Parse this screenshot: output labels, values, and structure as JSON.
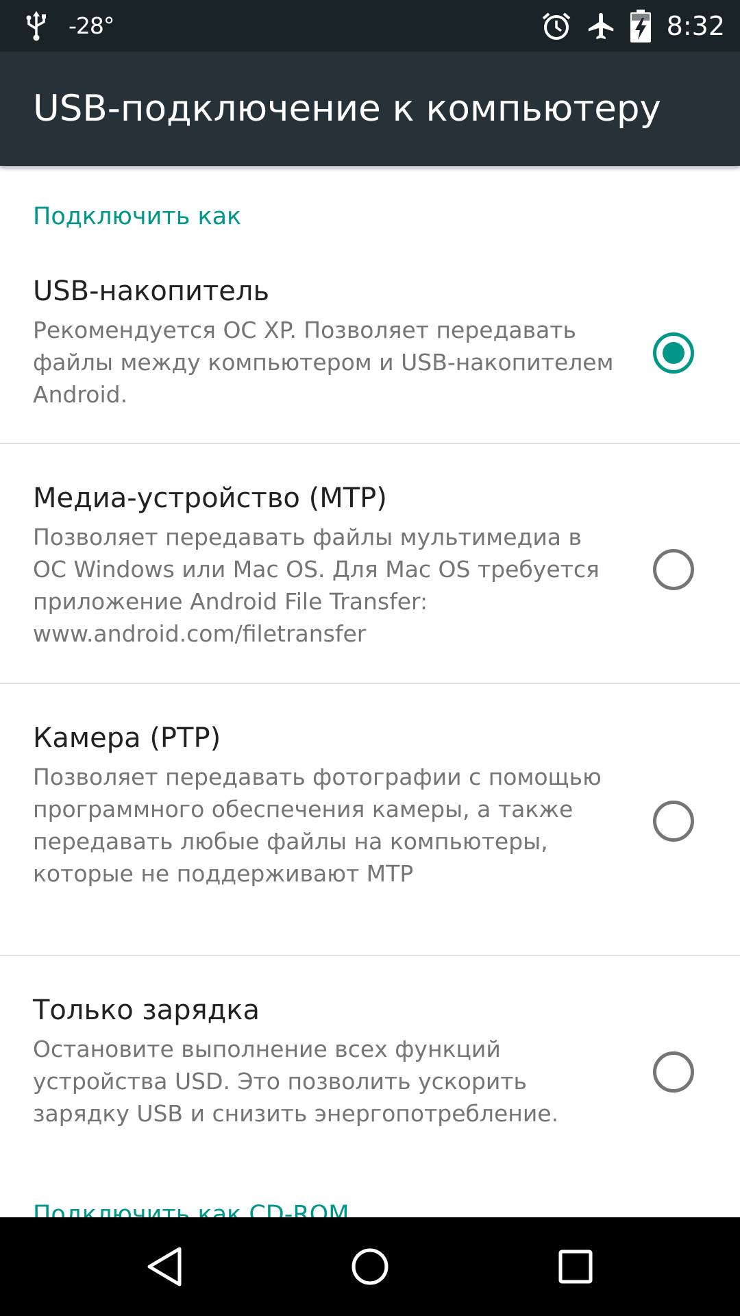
{
  "status_bar": {
    "temperature": "-28°",
    "time": "8:32",
    "icons": [
      "usb-icon",
      "alarm-icon",
      "airplane-mode-icon",
      "battery-charging-icon"
    ]
  },
  "app_bar": {
    "title": "USB-подключение к компьютеру"
  },
  "sections": {
    "connect_as": "Подключить как",
    "connect_as_cdrom": "Подключить как CD-ROM"
  },
  "options": [
    {
      "title": "USB-накопитель",
      "summary": "Рекомендуется ОС XP. Позволяет передавать файлы между компьютером и USB-накопителем Android.",
      "selected": true
    },
    {
      "title": "Медиа-устройство (MTP)",
      "summary": "Позволяет передавать файлы мультимедиа в ОС Windows или Mac OS. Для Mac OS требуется приложение Android File Transfer: www.android.com/filetransfer",
      "selected": false
    },
    {
      "title": "Камера (PTP)",
      "summary": "Позволяет передавать фотографии с помощью программного обеспечения камеры, а также передавать любые файлы на компьютеры, которые не поддерживают MTP",
      "selected": false
    },
    {
      "title": "Только зарядка",
      "summary": "Остановите выполнение всех функций устройства USD. Это позволить ускорить зарядку USB и снизить энергопотребление.",
      "selected": false
    }
  ],
  "colors": {
    "status_bar": "#1a2327",
    "app_bar": "#263238",
    "accent": "#009688",
    "title_text": "#212121",
    "summary_text": "#757575",
    "divider": "#e0e0e0",
    "nav_bar": "#000000"
  },
  "nav_bar": {
    "icons": [
      "back-icon",
      "home-icon",
      "recents-icon"
    ]
  }
}
